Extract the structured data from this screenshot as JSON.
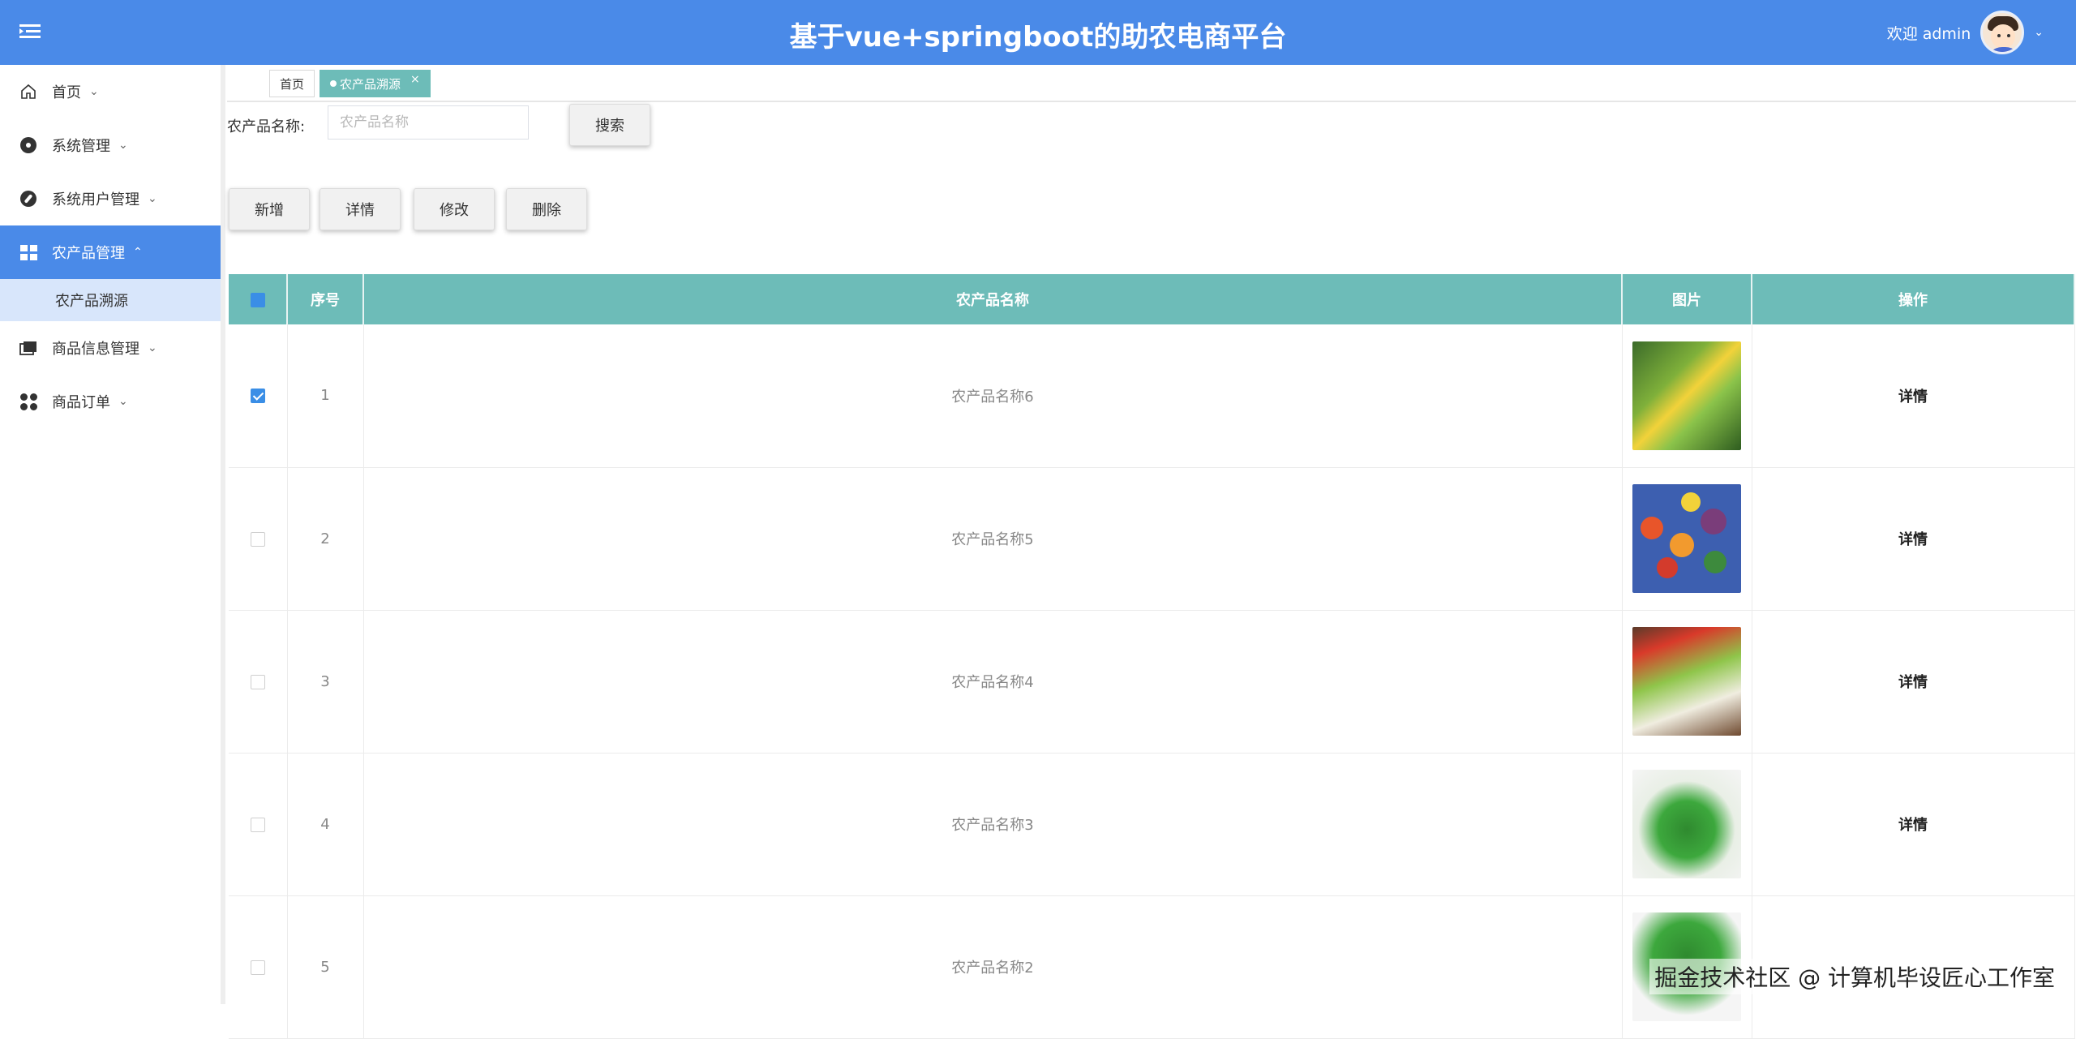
{
  "header": {
    "title": "基于vue+springboot的助农电商平台",
    "welcome": "欢迎 admin",
    "brand_color": "#4a8ae8"
  },
  "sidebar": {
    "items": [
      {
        "label": "首页",
        "icon": "home-icon",
        "chevron": "down"
      },
      {
        "label": "系统管理",
        "icon": "settings-dot-icon",
        "chevron": "down"
      },
      {
        "label": "系统用户管理",
        "icon": "compass-icon",
        "chevron": "down"
      },
      {
        "label": "农产品管理",
        "icon": "grid-icon",
        "chevron": "up",
        "active": true
      },
      {
        "label": "商品信息管理",
        "icon": "folder-icon",
        "chevron": "down"
      },
      {
        "label": "商品订单",
        "icon": "clover-icon",
        "chevron": "down"
      }
    ],
    "sub_item": "农产品溯源"
  },
  "tabs": {
    "home": "首页",
    "current": "农产品溯源",
    "close": "×"
  },
  "search": {
    "label": "农产品名称:",
    "placeholder": "农产品名称",
    "button": "搜索"
  },
  "toolbar": {
    "add": "新增",
    "detail": "详情",
    "edit": "修改",
    "delete": "删除"
  },
  "table": {
    "header_color": "#6dbcb8",
    "columns": [
      "序号",
      "农产品名称",
      "图片",
      "操作"
    ],
    "rows": [
      {
        "checked": true,
        "index": "1",
        "name": "农产品名称6",
        "action": "详情"
      },
      {
        "checked": false,
        "index": "2",
        "name": "农产品名称5",
        "action": "详情"
      },
      {
        "checked": false,
        "index": "3",
        "name": "农产品名称4",
        "action": "详情"
      },
      {
        "checked": false,
        "index": "4",
        "name": "农产品名称3",
        "action": "详情"
      },
      {
        "checked": false,
        "index": "5",
        "name": "农产品名称2",
        "action": ""
      }
    ]
  },
  "watermark": "掘金技术社区 @ 计算机毕设匠心工作室"
}
